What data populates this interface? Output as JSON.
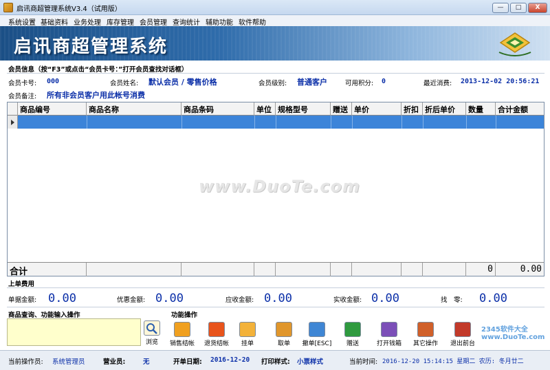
{
  "window": {
    "title": "启讯商超管理系统V3.4（试用版）",
    "buttons": [
      "—",
      "□",
      "X"
    ]
  },
  "menu": [
    "系统设置",
    "基础资料",
    "业务处理",
    "库存管理",
    "会员管理",
    "查询统计",
    "辅助功能",
    "软件帮助"
  ],
  "banner": {
    "title": "启讯商超管理系统"
  },
  "member": {
    "header": "会员信息（按“F3”或点击“会员卡号：”打开会员查找对话框）",
    "card_label": "会员卡号:",
    "card_value": "000",
    "name_label": "会员姓名:",
    "name_value": "默认会员 / 零售价格",
    "level_label": "会员级别:",
    "level_value": "普通客户",
    "points_label": "可用积分:",
    "points_value": "0",
    "last_label": "最近消费:",
    "last_value": "2013-12-02 20:56:21",
    "remark_label": "会员备注:",
    "remark_value": "所有非会员客户用此帐号消费"
  },
  "grid": {
    "columns": [
      "商品编号",
      "商品名称",
      "商品条码",
      "单位",
      "规格型号",
      "赠送",
      "单价",
      "折扣",
      "折后单价",
      "数量",
      "合计金额"
    ],
    "totals_label": "合计",
    "total_qty": "0",
    "total_amount": "0.00",
    "watermark": "www.DuoTe.com"
  },
  "last_order": {
    "section": "上单费用",
    "labels": [
      "单据金额:",
      "优惠金额:",
      "应收金额:",
      "实收金额:",
      "找　零:"
    ],
    "values": [
      "0.00",
      "0.00",
      "0.00",
      "0.00",
      "0.00"
    ]
  },
  "query": {
    "section": "商品查询、功能输入操作",
    "browse_label": "浏览"
  },
  "functions": {
    "section": "功能操作",
    "tools": [
      {
        "label": "销售结帐",
        "color": "#f0a020",
        "icon": "sale-checkout-icon"
      },
      {
        "label": "退货结帐",
        "color": "#e8541c",
        "icon": "return-checkout-icon"
      },
      {
        "label": "挂单",
        "color": "#f3b23a",
        "icon": "hold-order-icon"
      },
      {
        "label": "取单",
        "color": "#e0962c",
        "icon": "retrieve-order-icon"
      },
      {
        "label": "撤单[ESC]",
        "color": "#3f86d4",
        "icon": "cancel-order-icon"
      },
      {
        "label": "赠送",
        "color": "#2f9a3f",
        "icon": "gift-icon"
      },
      {
        "label": "打开钱箱",
        "color": "#7b4fb8",
        "icon": "cash-drawer-icon"
      },
      {
        "label": "其它操作",
        "color": "#d0602a",
        "icon": "other-operations-icon"
      },
      {
        "label": "退出前台",
        "color": "#c23a2a",
        "icon": "exit-icon"
      }
    ]
  },
  "status": {
    "operator_label": "当前操作员:",
    "operator_value": "系统管理员",
    "clerk_label": "营业员:",
    "clerk_value": "无",
    "date_label": "开单日期:",
    "date_value": "2016-12-20",
    "print_label": "打印样式:",
    "print_value": "小票样式",
    "time_label": "当前时间:",
    "time_value": "2016-12-20 15:14:15 星期二 农历: 冬月廿二"
  },
  "overlay_watermark": "2345软件大全 www.DuoTe.com"
}
